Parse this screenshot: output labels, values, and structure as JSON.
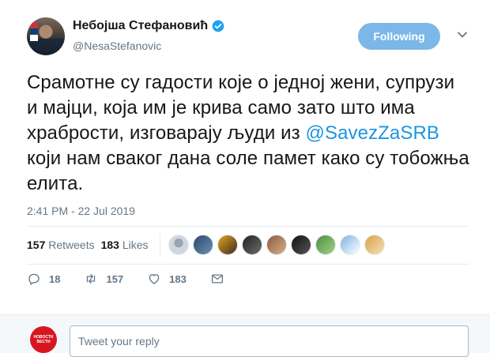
{
  "author": {
    "name": "Небојша Стефановић",
    "handle": "@NesaStefanovic",
    "verified": true,
    "avatar_icon": "profile-photo"
  },
  "follow_button": {
    "label": "Following",
    "color": "#7bb7e8"
  },
  "menu_icon": "chevron-down-icon",
  "tweet": {
    "text_before": "Срамотне су гадости које о једној жени, супрузи и мајци, која им је крива само зато што има храбрости, изговарају људи из ",
    "mention": "@SavezZaSRB",
    "text_after": " који нам сваког дана соле памет како су тобожња елита.",
    "mention_color": "#1b95e0"
  },
  "timestamp": "2:41 PM - 22 Jul 2019",
  "stats": {
    "retweets_count": "157",
    "retweets_label": "Retweets",
    "likes_count": "183",
    "likes_label": "Likes",
    "liker_faces": 9
  },
  "actions": {
    "reply_count": "18",
    "retweet_count": "157",
    "like_count": "183",
    "reply_icon": "reply-icon",
    "retweet_icon": "retweet-icon",
    "like_icon": "heart-icon",
    "dm_icon": "direct-message-icon"
  },
  "reply_box": {
    "placeholder": "Tweet your reply",
    "avatar_top": "НОВОСТИ",
    "avatar_bottom": "ВЕСТИ"
  }
}
